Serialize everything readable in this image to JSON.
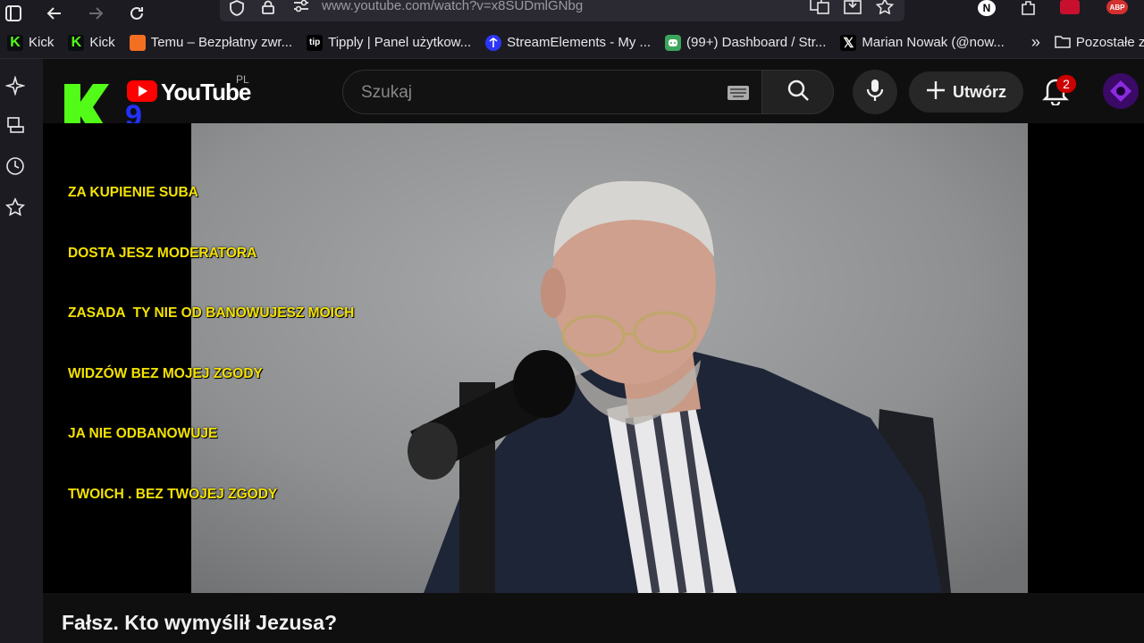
{
  "browser": {
    "url": "www.youtube.com/watch?v=x8SUDmlGNbg"
  },
  "bookmarks": [
    {
      "label": "Kick",
      "icon": "kick-icon",
      "color": "#53fc18"
    },
    {
      "label": "Kick",
      "icon": "kick-icon",
      "color": "#53fc18"
    },
    {
      "label": "Temu – Bezpłatny zwr...",
      "icon": "temu-icon",
      "color": "#f36f21"
    },
    {
      "label": "Tipply | Panel użytkow...",
      "icon": "tipply-icon",
      "color": "#ffffff"
    },
    {
      "label": "StreamElements - My ...",
      "icon": "streamelements-icon",
      "color": "#2d36f5"
    },
    {
      "label": "(99+) Dashboard / Str...",
      "icon": "discord-icon",
      "color": "#3ba55c"
    },
    {
      "label": "Marian Nowak (@now...",
      "icon": "x-icon",
      "color": "#ffffff"
    }
  ],
  "bookmarks_more": "Pozostałe zak",
  "badges": {
    "extension_n": "N",
    "extension_abp": "ABP"
  },
  "youtube": {
    "logo_text": "YouTube",
    "region": "PL",
    "search_placeholder": "Szukaj",
    "create_label": "Utwórz",
    "notifications_count": "2"
  },
  "overlay": {
    "lines": [
      "ZA KUPIENIE SUBA",
      "DOSTA JESZ MODERATORA",
      "ZASADA  TY NIE OD BANOWUJESZ MOICH",
      "WIDZÓW BEZ MOJEJ ZGODY",
      "JA NIE ODBANOWUJE",
      "TWOICH . BEZ TWOJEJ ZGODY"
    ],
    "color": "#f4e200"
  },
  "video": {
    "title": "Fałsz. Kto wymyślił Jezusa?"
  }
}
